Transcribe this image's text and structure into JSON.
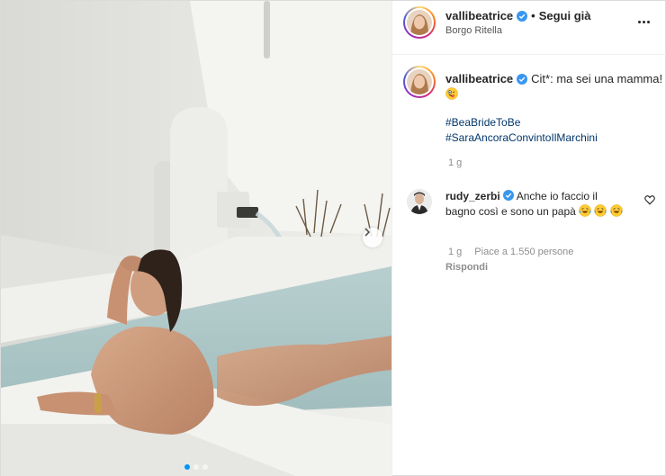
{
  "post": {
    "username": "vallibeatrice",
    "separator": "•",
    "follow_label": "Segui già",
    "location": "Borgo Ritella",
    "media_dots_count": 3,
    "media_active_dot": 1
  },
  "caption": {
    "username": "vallibeatrice",
    "text": "Cit*: ma sei una mamma!",
    "hashtags": [
      "#BeaBrideToBe",
      "#SaraAncoraConvintoIlMarchini"
    ],
    "time": "1 g"
  },
  "comment": {
    "username": "rudy_zerbi",
    "text": "Anche io faccio il bagno così e sono un papà",
    "time": "1 g",
    "likes": "Piace a 1.550 persone",
    "reply_label": "Rispondi"
  },
  "colors": {
    "link": "#00376b",
    "verified": "#3897f0",
    "meta_gray": "#8e8e8e",
    "active_dot": "#0095f6"
  },
  "icons": {
    "verified": "verified-badge-icon",
    "more": "more-options-icon",
    "heart": "heart-outline-icon",
    "next": "chevron-right-icon",
    "emoji_wink": "winking-tongue-emoji",
    "emoji_laugh": "laughing-tears-emoji"
  }
}
